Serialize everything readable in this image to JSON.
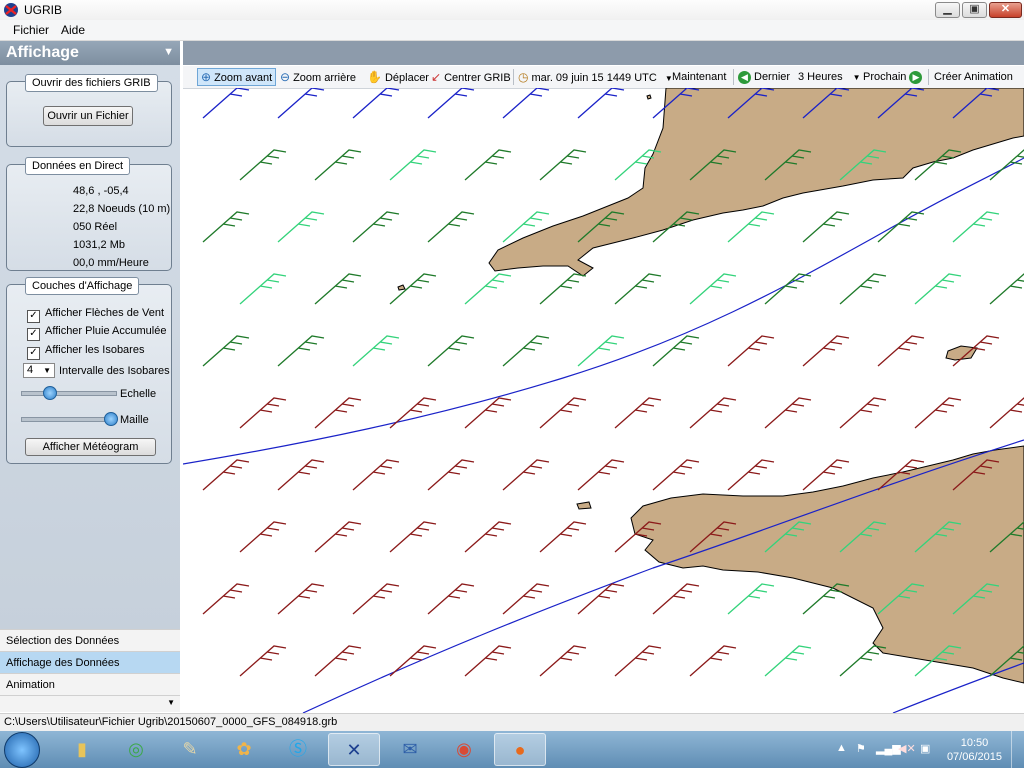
{
  "window": {
    "title": "UGRIB",
    "minimize": "▁",
    "maximize": "▣",
    "close": "✕"
  },
  "menu": [
    "Fichier",
    "Aide"
  ],
  "panel": {
    "title": "Affichage",
    "collapse_icon": "chevron-down-icon",
    "open_group": {
      "title": "Ouvrir des fichiers GRIB",
      "button": "Ouvrir un Fichier"
    },
    "live_group": {
      "title": "Données en Direct",
      "lines": [
        "48,6 ,  -05,4",
        "22,8 Noeuds (10 m)",
        "050 Réel",
        "1031,2 Mb",
        "00,0 mm/Heure"
      ]
    },
    "layers_group": {
      "title": "Couches d'Affichage",
      "checks": [
        {
          "label": "Afficher Flèches de Vent",
          "checked": true
        },
        {
          "label": "Afficher Pluie Accumulée",
          "checked": true
        },
        {
          "label": "Afficher les Isobares",
          "checked": true
        }
      ],
      "isobar_value": "4",
      "isobar_label": "Intervalle des Isobares",
      "scale_label": "Echelle",
      "scale_level": 0.3,
      "mesh_label": "Maille",
      "mesh_level": 0.95,
      "meteogram_button": "Afficher Météogram"
    },
    "splitter_grip": "•••••",
    "nav": [
      "Sélection des Données",
      "Affichage des Données",
      "Animation"
    ]
  },
  "toolbar": {
    "zoom_in": "Zoom avant",
    "zoom_out": "Zoom arrière",
    "pan": "Déplacer",
    "center": "Centrer GRIB",
    "datetime": "mar. 09 juin 15 1449 UTC",
    "now": "Maintenant",
    "previous": "Dernier",
    "step": "3 Heures",
    "next": "Prochain",
    "animate": "Créer Animation"
  },
  "statusbar": {
    "path": "C:\\Users\\Utilisateur\\Fichier Ugrib\\20150607_0000_GFS_084918.grb"
  },
  "taskbar": {
    "apps": [
      "file-explorer-icon",
      "sync-icon",
      "notes-icon",
      "paint-icon",
      "skype-icon",
      "ugrib-icon",
      "thunderbird-icon",
      "chrome-icon",
      "firefox-icon"
    ],
    "time": "10:50",
    "date": "07/06/2015"
  },
  "colors": {
    "land": "#c8ab86",
    "isobar": "#1a22c8",
    "wind_light": "#34d37b",
    "wind_mid": "#1f7a2a",
    "wind_strong": "#8b1a1a",
    "panel_header": "#8d9bab"
  }
}
